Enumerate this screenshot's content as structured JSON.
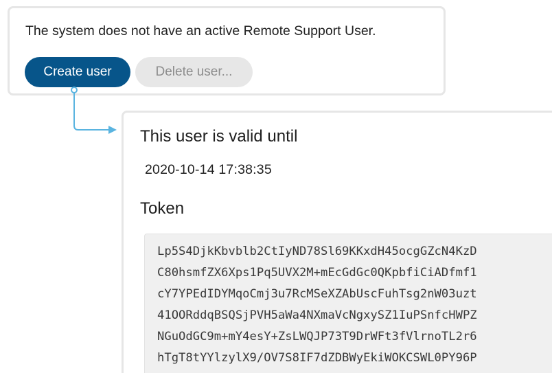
{
  "remote_support": {
    "status_message": "The system does not have an active Remote Support User.",
    "create_button_label": "Create user",
    "delete_button_label": "Delete user..."
  },
  "user_details": {
    "valid_until_label": "This user is valid until",
    "valid_until_value": "2020-10-14 17:38:35",
    "token_label": "Token",
    "token_lines": [
      "Lp5S4DjkKbvblb2CtIyND78Sl69KKxdH45ocgGZcN4KzD",
      "C80hsmfZX6Xps1Pq5UVX2M+mEcGdGc0QKpbfiCiADfmf1",
      "cY7YPEdIDYMqoCmj3u7RcMSeXZAbUscFuhTsg2nW03uzt",
      "41OORddqBSQSjPVH5aWa4NXmaVcNgxySZ1IuPSnfcHWPZ",
      "NGuOdGC9m+mY4esY+ZsLWQJP73T9DrWFt3fVlrnoTL2r6",
      "hTgT8tYYlzylX9/OV7S8IF7dZDBWyEkiWOKCSWL0PY96P"
    ]
  },
  "colors": {
    "primary_button": "#07558a",
    "disabled_button": "#e7e7e7",
    "connector": "#5ab4e0"
  }
}
